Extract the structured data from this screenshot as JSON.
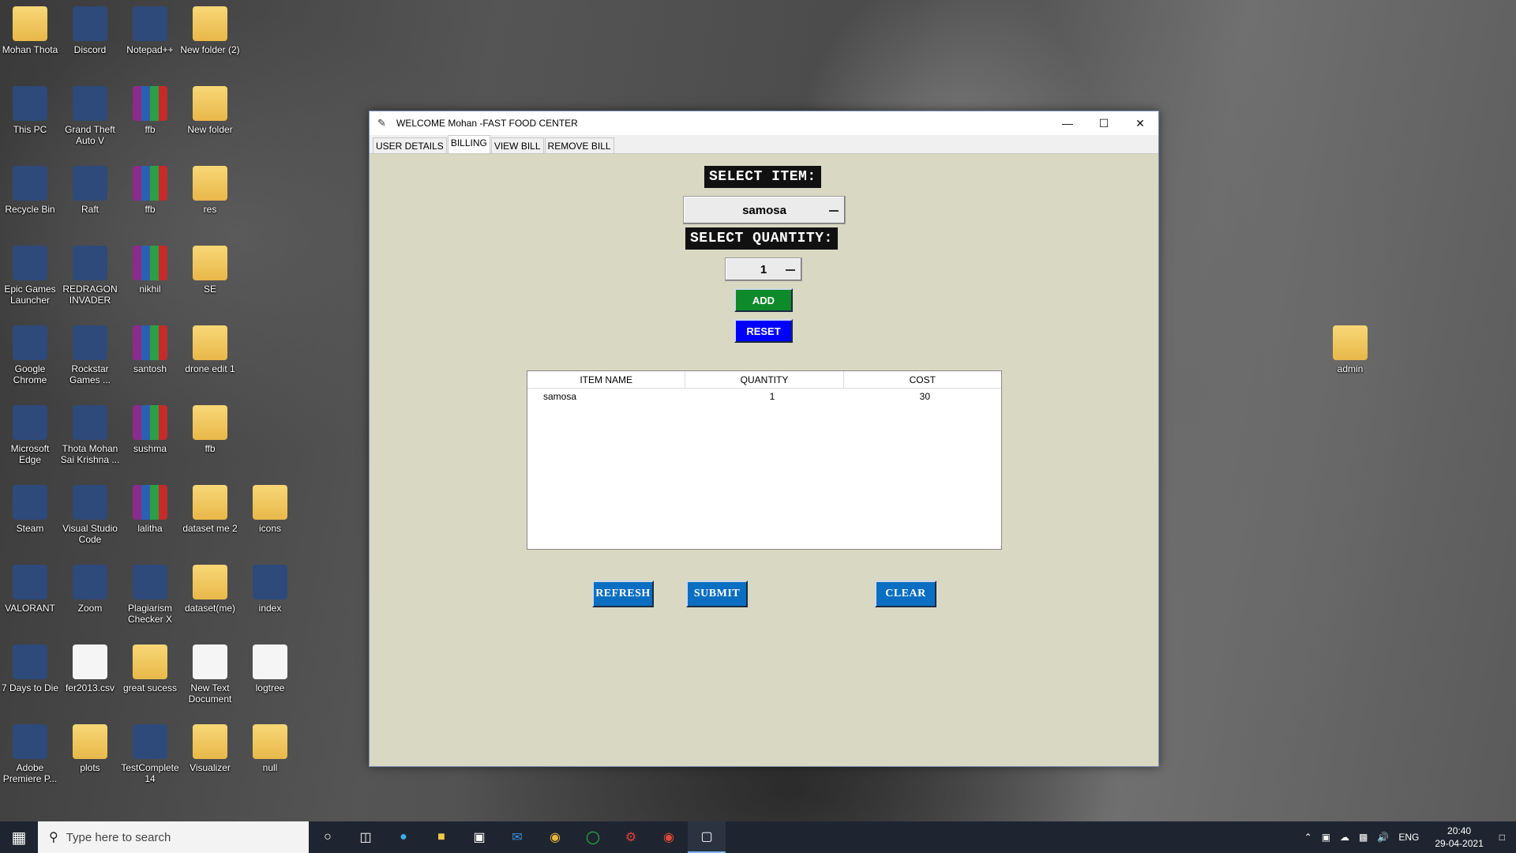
{
  "desktop_icons": [
    {
      "label": "Mohan Thota",
      "glyph": "folder-user-icon"
    },
    {
      "label": "Discord",
      "glyph": "discord-icon"
    },
    {
      "label": "Notepad++",
      "glyph": "notepadpp-icon"
    },
    {
      "label": "New folder (2)",
      "glyph": "folder-icon"
    },
    {
      "label": "This PC",
      "glyph": "computer-icon"
    },
    {
      "label": "Grand Theft Auto V",
      "glyph": "gta-icon"
    },
    {
      "label": "ffb",
      "glyph": "winrar-icon"
    },
    {
      "label": "New folder",
      "glyph": "folder-icon"
    },
    {
      "label": "Recycle Bin",
      "glyph": "recycle-bin-icon"
    },
    {
      "label": "Raft",
      "glyph": "raft-icon"
    },
    {
      "label": "ffb",
      "glyph": "winrar-icon"
    },
    {
      "label": "res",
      "glyph": "folder-icon"
    },
    {
      "label": "Epic Games Launcher",
      "glyph": "epic-games-icon"
    },
    {
      "label": "REDRAGON INVADER",
      "glyph": "redragon-icon"
    },
    {
      "label": "nikhil",
      "glyph": "winrar-icon"
    },
    {
      "label": "SE",
      "glyph": "folder-icon"
    },
    {
      "label": "Google Chrome",
      "glyph": "chrome-icon"
    },
    {
      "label": "Rockstar Games ...",
      "glyph": "rockstar-icon"
    },
    {
      "label": "santosh",
      "glyph": "winrar-icon"
    },
    {
      "label": "drone edit 1",
      "glyph": "folder-icon"
    },
    {
      "label": "Microsoft Edge",
      "glyph": "edge-icon"
    },
    {
      "label": "Thota Mohan Sai Krishna ...",
      "glyph": "chrome-profile-icon"
    },
    {
      "label": "sushma",
      "glyph": "winrar-icon"
    },
    {
      "label": "ffb",
      "glyph": "folder-icon"
    },
    {
      "label": "Steam",
      "glyph": "steam-icon"
    },
    {
      "label": "Visual Studio Code",
      "glyph": "vscode-icon"
    },
    {
      "label": "lalitha",
      "glyph": "winrar-icon"
    },
    {
      "label": "dataset me 2",
      "glyph": "folder-icon"
    },
    {
      "label": "icons",
      "glyph": "folder-icon"
    },
    {
      "label": "VALORANT",
      "glyph": "valorant-icon"
    },
    {
      "label": "Zoom",
      "glyph": "zoom-icon"
    },
    {
      "label": "Plagiarism Checker X",
      "glyph": "plagiarism-icon"
    },
    {
      "label": "dataset(me)",
      "glyph": "folder-icon"
    },
    {
      "label": "index",
      "glyph": "edge-icon"
    },
    {
      "label": "7 Days to Die",
      "glyph": "game-icon"
    },
    {
      "label": "fer2013.csv",
      "glyph": "file-icon"
    },
    {
      "label": "great sucess",
      "glyph": "folder-icon"
    },
    {
      "label": "New Text Document",
      "glyph": "text-file-icon"
    },
    {
      "label": "logtree",
      "glyph": "script-icon"
    },
    {
      "label": "Adobe Premiere P...",
      "glyph": "premiere-icon"
    },
    {
      "label": "plots",
      "glyph": "folder-icon"
    },
    {
      "label": "TestComplete 14",
      "glyph": "testcomplete-icon"
    },
    {
      "label": "Visualizer",
      "glyph": "folder-icon"
    },
    {
      "label": "null",
      "glyph": "folder-icon"
    },
    {
      "label": "admin",
      "glyph": "folder-icon"
    }
  ],
  "window": {
    "title": "WELCOME Mohan -FAST FOOD CENTER",
    "tabs": [
      {
        "label": "USER DETAILS",
        "active": false
      },
      {
        "label": "BILLING",
        "active": true
      },
      {
        "label": "VIEW BILL",
        "active": false
      },
      {
        "label": "REMOVE BILL",
        "active": false
      }
    ],
    "billing": {
      "select_item_label": "SELECT ITEM:",
      "selected_item": "samosa",
      "select_quantity_label": "SELECT QUANTITY:",
      "selected_quantity": "1",
      "add_label": "ADD",
      "reset_label": "RESET",
      "table": {
        "columns": [
          "ITEM NAME",
          "QUANTITY",
          "COST"
        ],
        "rows": [
          [
            "samosa",
            "1",
            "30"
          ]
        ]
      },
      "refresh_label": "REFRESH",
      "submit_label": "SUBMIT",
      "clear_label": "CLEAR"
    },
    "colors": {
      "background": "#d9d8c2",
      "add": "#0f8a2a",
      "reset": "#0000ff",
      "action": "#0a6fc2"
    }
  },
  "taskbar": {
    "search_placeholder": "Type here to search",
    "language": "ENG",
    "time": "20:40",
    "date": "29-04-2021"
  }
}
